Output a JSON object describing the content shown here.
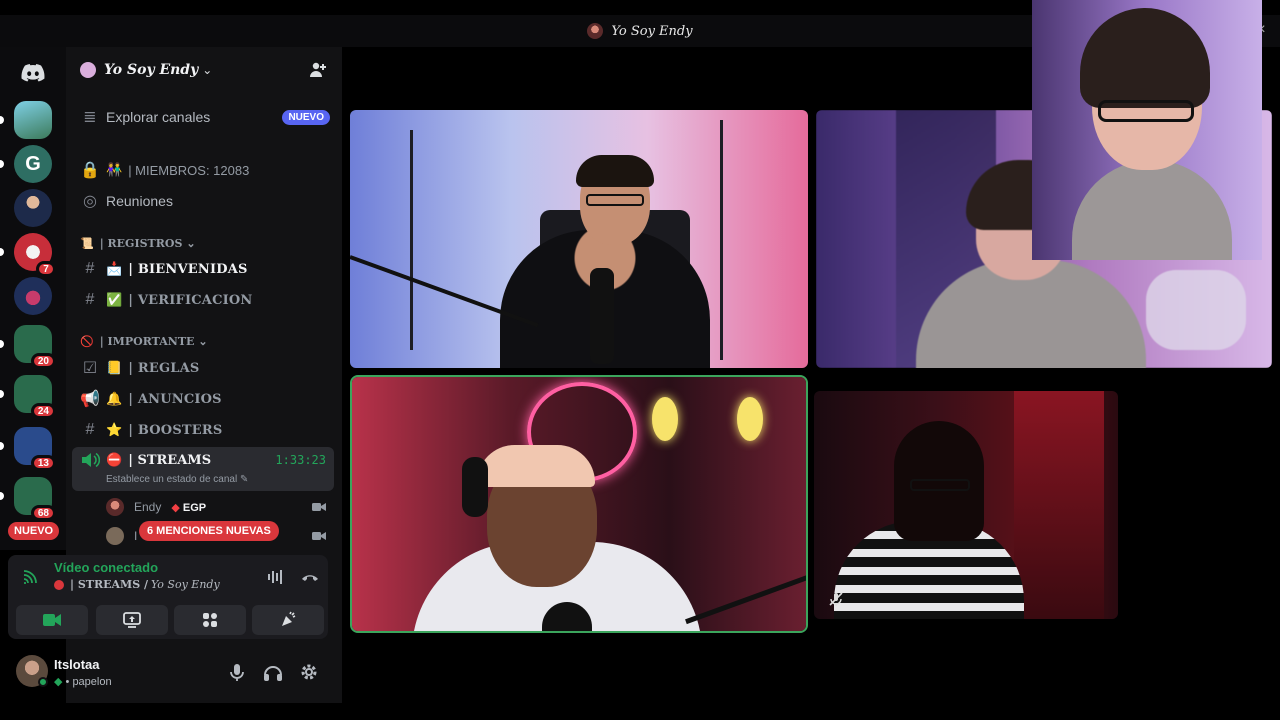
{
  "window": {
    "title": "Yo Soy Endy",
    "close_glyph": "×"
  },
  "rail": {
    "home_icon": "discord-logo-icon",
    "servers": [
      {
        "name": "server-1",
        "badge": ""
      },
      {
        "name": "server-2",
        "badge": ""
      },
      {
        "name": "server-3",
        "badge": ""
      },
      {
        "name": "server-4",
        "badge": "7"
      },
      {
        "name": "server-5",
        "badge": ""
      },
      {
        "name": "server-6",
        "badge": "20"
      },
      {
        "name": "server-7",
        "badge": "24"
      },
      {
        "name": "server-8",
        "badge": "13"
      },
      {
        "name": "server-9",
        "badge": "68"
      }
    ],
    "nuevo_label": "NUEVO"
  },
  "server": {
    "name": "Yo Soy Endy"
  },
  "channels": {
    "explore": {
      "label": "Explorar canales",
      "pill": "NUEVO"
    },
    "members": {
      "emoji": "👫",
      "label": "| MIEMBROS: 12083"
    },
    "events": {
      "label": "Reuniones"
    },
    "cat_registros": {
      "emoji": "📜",
      "label": "| REGISTROS"
    },
    "bienvenidas": {
      "emoji": "📩",
      "label": "| BIENVENIDAS"
    },
    "verificacion": {
      "emoji": "✅",
      "label": "| VERIFICACION"
    },
    "cat_importante": {
      "emoji": "🚫",
      "label": "| IMPORTANTE"
    },
    "reglas": {
      "emoji": "📒",
      "label": "| REGLAS"
    },
    "anuncios": {
      "emoji": "🔔",
      "label": "| ANUNCIOS"
    },
    "boosters": {
      "emoji": "⭐",
      "label": "| BOOSTERS"
    },
    "streams": {
      "emoji": "⛔",
      "label": "| STREAMS",
      "time": "1:33:23",
      "status_placeholder": "Establece un estado de canal"
    }
  },
  "voice_members": [
    {
      "name": "Endy",
      "tag": "EGP"
    },
    {
      "name": "I",
      "tag": ""
    }
  ],
  "mentions_label": "6 MENCIONES NUEVAS",
  "voice_panel": {
    "title": "Vídeo conectado",
    "channel": "| STREAMS /",
    "server": "Yo Soy Endy"
  },
  "user": {
    "name": "Itslotaa",
    "status": "• papelon"
  },
  "colors": {
    "accent": "#5865f2",
    "connected": "#23a55a",
    "danger": "#da373c",
    "speaking": "#3ba55c"
  }
}
